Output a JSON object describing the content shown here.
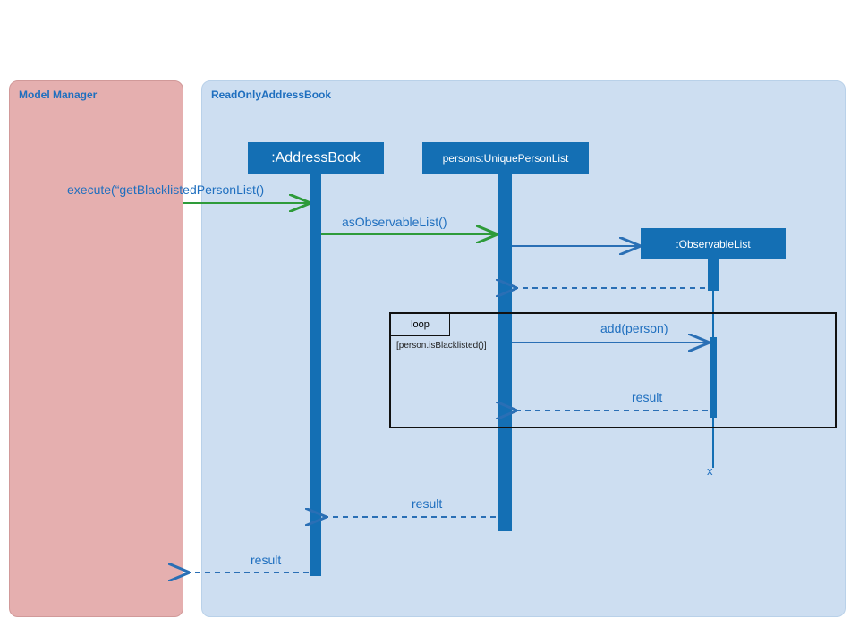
{
  "chart_data": {
    "type": "sequence-diagram",
    "frames": [
      {
        "name": "Model Manager"
      },
      {
        "name": "ReadOnlyAddressBook"
      }
    ],
    "lifelines": [
      {
        "name": ":AddressBook"
      },
      {
        "name": "persons:UniquePersonList"
      },
      {
        "name": ":ObservableList",
        "destroyed": true
      }
    ],
    "messages": [
      {
        "from": "Model Manager",
        "to": ":AddressBook",
        "label": "execute(“getBlacklistedPersonList()",
        "kind": "sync"
      },
      {
        "from": ":AddressBook",
        "to": "persons:UniquePersonList",
        "label": "asObservableList()",
        "kind": "sync"
      },
      {
        "from": "persons:UniquePersonList",
        "to": ":ObservableList",
        "label": "",
        "kind": "create"
      },
      {
        "from": ":ObservableList",
        "to": "persons:UniquePersonList",
        "label": "",
        "kind": "return"
      },
      {
        "from": "persons:UniquePersonList",
        "to": ":ObservableList",
        "label": "add(person)",
        "kind": "sync",
        "fragment": "loop",
        "guard": "[person.isBlacklisted()]"
      },
      {
        "from": ":ObservableList",
        "to": "persons:UniquePersonList",
        "label": "result",
        "kind": "return",
        "fragment": "loop"
      },
      {
        "from": "persons:UniquePersonList",
        "to": ":AddressBook",
        "label": "result",
        "kind": "return"
      },
      {
        "from": ":AddressBook",
        "to": "Model Manager",
        "label": "result",
        "kind": "return"
      }
    ],
    "fragments": [
      {
        "type": "loop",
        "guard": "[person.isBlacklisted()]"
      }
    ]
  },
  "frames": {
    "model": "Model Manager",
    "read": "ReadOnlyAddressBook"
  },
  "lifelines": {
    "addressBook": ":AddressBook",
    "uniqueList": "persons:UniquePersonList",
    "obsList": ":ObservableList"
  },
  "messages": {
    "execute": "execute(“getBlacklistedPersonList()",
    "asObservable": "asObservableList()",
    "add": "add(person)",
    "result": "result"
  },
  "loop": {
    "label": "loop",
    "guard": "[person.isBlacklisted()]"
  },
  "destroy": "x"
}
